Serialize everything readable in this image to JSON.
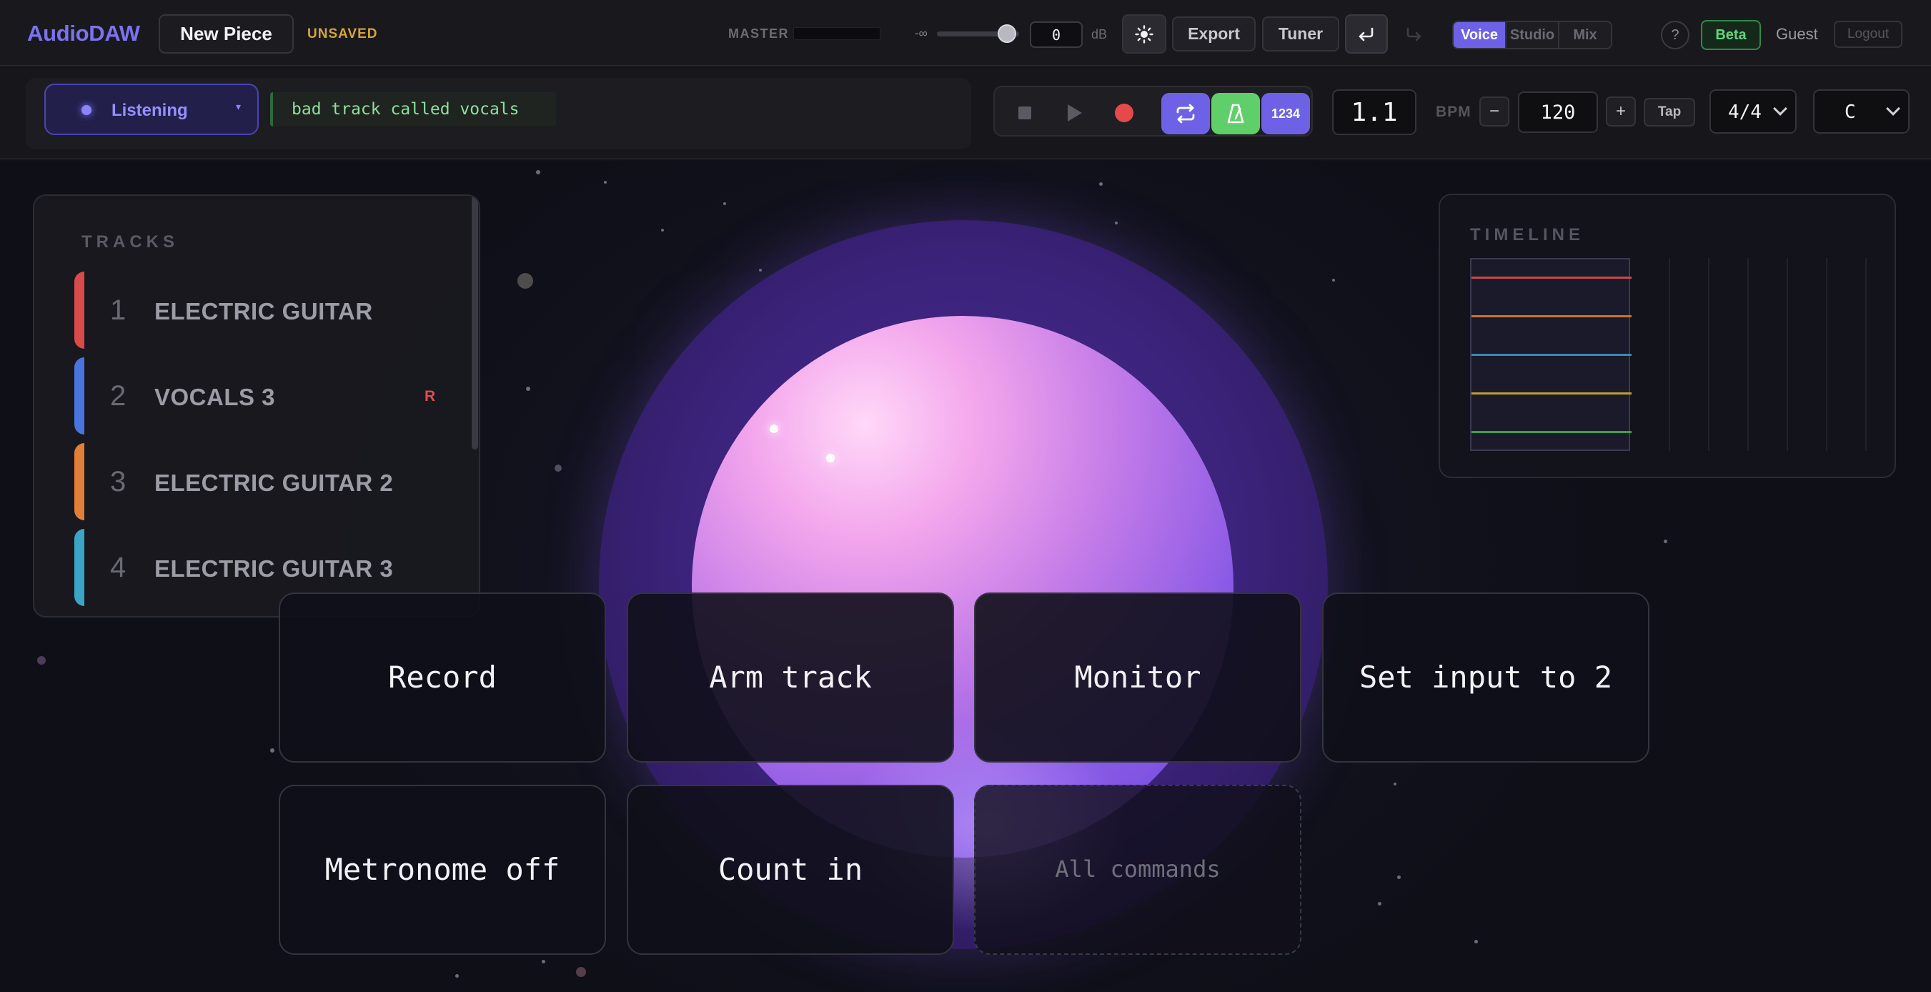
{
  "app": {
    "brand": "AudioDAW",
    "piece_name": "New Piece",
    "save_status": "UNSAVED"
  },
  "topbar": {
    "master_label": "MASTER",
    "gain_min_label": "-∞",
    "gain_value": "0",
    "gain_unit": "dB",
    "export_label": "Export",
    "tuner_label": "Tuner",
    "modes": [
      "Voice",
      "Studio",
      "Mix"
    ],
    "active_mode": "Voice",
    "help_label": "?",
    "beta_label": "Beta",
    "user_label": "Guest",
    "logout_label": "Logout"
  },
  "voice": {
    "state_label": "Listening",
    "transcript": "bad track called vocals"
  },
  "transport": {
    "count_in_label": "1234",
    "position": "1.1",
    "bpm_label": "BPM",
    "bpm_value": "120",
    "bpm_minus": "−",
    "bpm_plus": "+",
    "tap_label": "Tap",
    "time_signature": "4/4",
    "key": "C"
  },
  "tracks": {
    "title": "TRACKS",
    "items": [
      {
        "num": "1",
        "name": "ELECTRIC GUITAR",
        "color": "#d94a4a",
        "badge": ""
      },
      {
        "num": "2",
        "name": "VOCALS 3",
        "color": "#4a74e0",
        "badge": "R"
      },
      {
        "num": "3",
        "name": "ELECTRIC GUITAR 2",
        "color": "#e07e3a",
        "badge": ""
      },
      {
        "num": "4",
        "name": "ELECTRIC GUITAR 3",
        "color": "#3aa6c4",
        "badge": ""
      }
    ]
  },
  "timeline": {
    "title": "TIMELINE",
    "lane_colors": [
      "#c84848",
      "#d07030",
      "#3a8ab0",
      "#c89a30",
      "#3aa050"
    ]
  },
  "commands": {
    "record": "Record",
    "arm_track": "Arm track",
    "monitor": "Monitor",
    "set_input": "Set input to 2",
    "metronome_off": "Metronome off",
    "count_in": "Count in",
    "all_commands": "All commands"
  },
  "colors": {
    "accent": "#6d62e6",
    "record": "#e44a4a",
    "metronome_on": "#5fcf6a",
    "unsaved": "#d6a43a"
  }
}
